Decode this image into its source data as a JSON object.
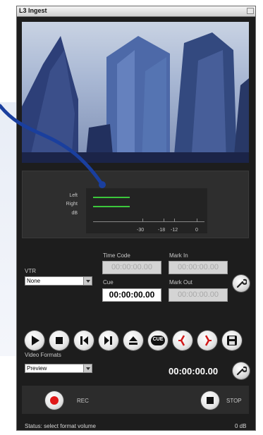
{
  "window": {
    "title": "L3 Ingest"
  },
  "meters": {
    "left_label": "Left",
    "right_label": "Right",
    "db_label": "dB",
    "scale": [
      "-30",
      "-18",
      "-12",
      "0"
    ],
    "left_level": 0.33,
    "right_level": 0.33,
    "bar_color": "#3cc83c"
  },
  "vtr": {
    "label": "VTR",
    "selected": "None",
    "timecode_label": "Time Code",
    "timecode_value": "00:00:00.00",
    "cue_label": "Cue",
    "cue_value": "00:00:00.00",
    "markin_label": "Mark In",
    "markin_value": "00:00:00.00",
    "markout_label": "Mark Out",
    "markout_value": "00:00:00.00"
  },
  "transport": {
    "cue_button": "CUE",
    "icons": [
      "play-icon",
      "stop-icon",
      "step-back-icon",
      "step-forward-icon",
      "eject-icon",
      "cue-icon",
      "mark-in-icon",
      "mark-out-icon",
      "save-icon"
    ]
  },
  "video_formats": {
    "label": "Video Formats",
    "selected": "Preview"
  },
  "record_timecode": "00:00:00.00",
  "record": {
    "rec_label": "REC",
    "stop_label": "STOP",
    "rec_color": "#e01818"
  },
  "status": {
    "text": "Status: select format volume",
    "level": "0 dB"
  },
  "accent_color": "#1a3f9e"
}
